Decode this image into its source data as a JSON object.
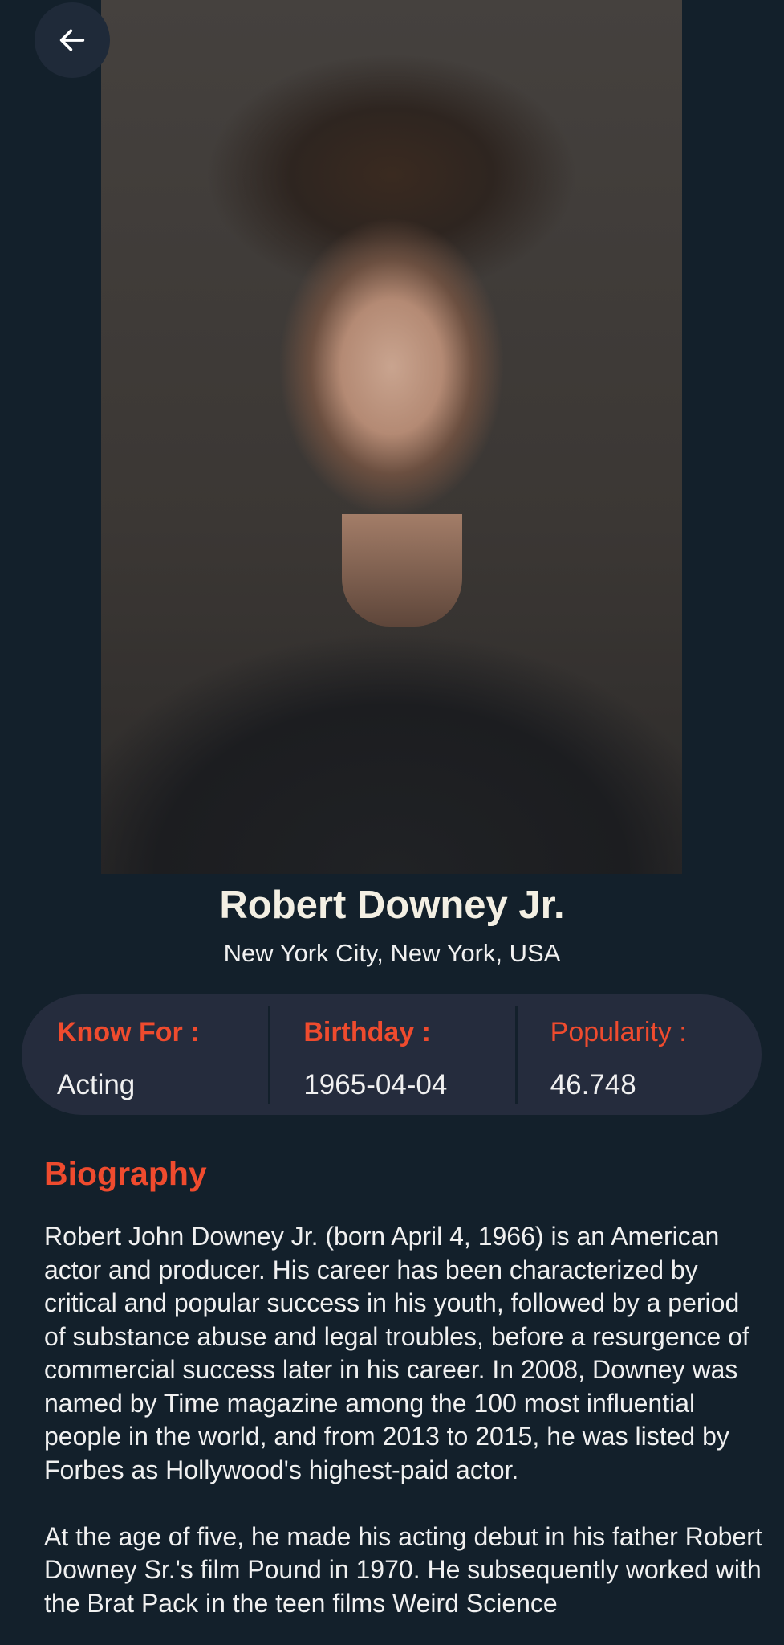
{
  "profile": {
    "name": "Robert Downey Jr.",
    "place_of_birth": "New York City, New York, USA",
    "photo_alt": "Robert Downey Jr."
  },
  "info": {
    "known_for_label": "Know For :",
    "known_for_value": "Acting",
    "birthday_label": "Birthday :",
    "birthday_value": "1965-04-04",
    "popularity_label": "Popularity :",
    "popularity_value": "46.748"
  },
  "biography": {
    "heading": "Biography",
    "text": "Robert John Downey Jr. (born April 4, 1966) is an American actor and producer. His career has been characterized by critical and popular success in his youth, followed by a period of substance abuse and legal troubles, before a resurgence of commercial success later in his career. In 2008, Downey was named by Time magazine among the 100 most influential people in the world, and from 2013 to 2015, he was listed by Forbes as Hollywood's highest-paid actor.\n\nAt the age of five, he made his acting debut in his father Robert Downey Sr.'s film Pound in 1970. He subsequently worked with the Brat Pack in the teen films Weird Science"
  },
  "icons": {
    "back": "arrow-left-icon"
  },
  "colors": {
    "background": "#13202b",
    "card": "#252c3d",
    "accent": "#ef4b2e",
    "name_text": "#f3efe3"
  }
}
